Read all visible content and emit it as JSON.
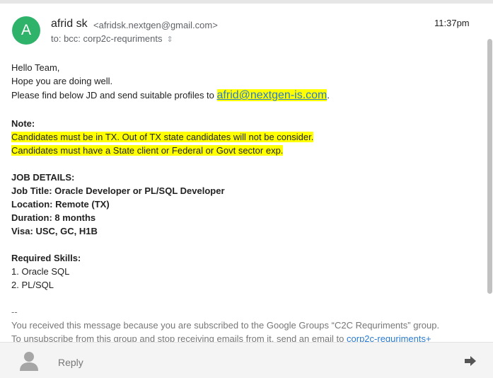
{
  "header": {
    "avatar_letter": "A",
    "sender_name": "afrid sk",
    "sender_email": "<afridsk.nextgen@gmail.com>",
    "recipients": "to: bcc: corp2c-requriments",
    "recipients_toggle_icon": "expand-icon",
    "time": "11:37pm"
  },
  "message": {
    "greeting": "Hello Team,",
    "line2": "Hope you are doing well.",
    "line3_prefix": "Please find below JD and send suitable profiles to ",
    "line3_link": "afrid@nextgen-is.com",
    "line3_suffix": ".",
    "note_heading": "Note:",
    "note_line1": "Candidates must be in TX. Out of TX state candidates will not be consider.",
    "note_line2": "Candidates must have a State client or Federal or Govt sector exp.",
    "job_heading": "JOB DETAILS:",
    "job_title": "Job Title: Oracle Developer or PL/SQL Developer",
    "job_location": "Location: Remote (TX)",
    "job_duration": "Duration: 8 months",
    "job_visa": "Visa: USC, GC, H1B",
    "skills_heading": "Required Skills:",
    "skill1": "1. Oracle SQL",
    "skill2": "2. PL/SQL",
    "sig_sep": "--",
    "footer_line1": "You received this message because you are subscribed to the Google Groups “C2C Requriments” group.",
    "footer_line2_prefix": "To unsubscribe from this group and stop receiving emails from it, send an email to ",
    "footer_line2_link": "corp2c-requriments+"
  },
  "reply_bar": {
    "avatar_icon": "person-icon",
    "reply_label": "Reply",
    "send_icon": "arrow-right-icon"
  },
  "colors": {
    "avatar": "#2fb36a",
    "highlight": "#ffff00",
    "link": "#2a7bd1"
  }
}
